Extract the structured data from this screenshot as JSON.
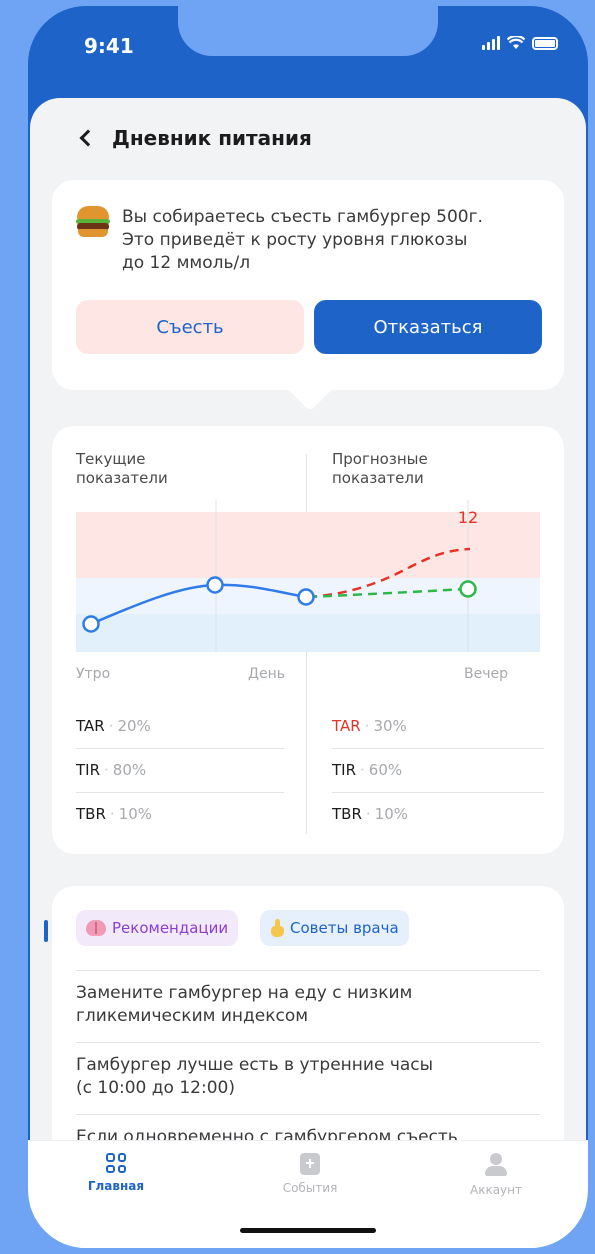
{
  "status_bar": {
    "time": "9:41"
  },
  "header": {
    "title": "Дневник питания"
  },
  "alert": {
    "icon": "burger-icon",
    "lines": [
      "Вы собираетесь съесть гамбургер 500г.",
      "Это приведёт к росту уровня глюкозы",
      "до 12 ммоль/л"
    ],
    "eat_label": "Съесть",
    "refuse_label": "Отказаться"
  },
  "chart": {
    "current_title": [
      "Текущие",
      "показатели"
    ],
    "forecast_title": [
      "Прогнозные",
      "показатели"
    ],
    "peak_label": "12",
    "x_labels": [
      "Утро",
      "День",
      "Вечер"
    ],
    "current_metrics": [
      {
        "label": "TAR",
        "value": "20%"
      },
      {
        "label": "TIR",
        "value": "80%"
      },
      {
        "label": "TBR",
        "value": "10%"
      }
    ],
    "forecast_metrics": [
      {
        "label": "TAR",
        "value": "30%"
      },
      {
        "label": "TIR",
        "value": "60%"
      },
      {
        "label": "TBR",
        "value": "10%"
      }
    ],
    "colors": {
      "actual": "#2f7be8",
      "forecast_high": "#e53325",
      "forecast_ok": "#2db84a",
      "high_zone": "#fde6e4",
      "target_zone": "#eef5fe",
      "low_zone": "#e2f0fc"
    }
  },
  "recommendations": {
    "chip_rec": "Рекомендации",
    "chip_doctor": "Советы врача",
    "tips": [
      [
        "Замените гамбургер на еду с низким",
        "гликемическим индексом"
      ],
      [
        "Гамбургер лучше есть в утренние часы",
        "(с 10:00 до 12:00)"
      ],
      [
        "Если одновременно с гамбургером съесть"
      ]
    ]
  },
  "tabbar": {
    "home": "Главная",
    "events": "События",
    "account": "Аккаунт"
  }
}
